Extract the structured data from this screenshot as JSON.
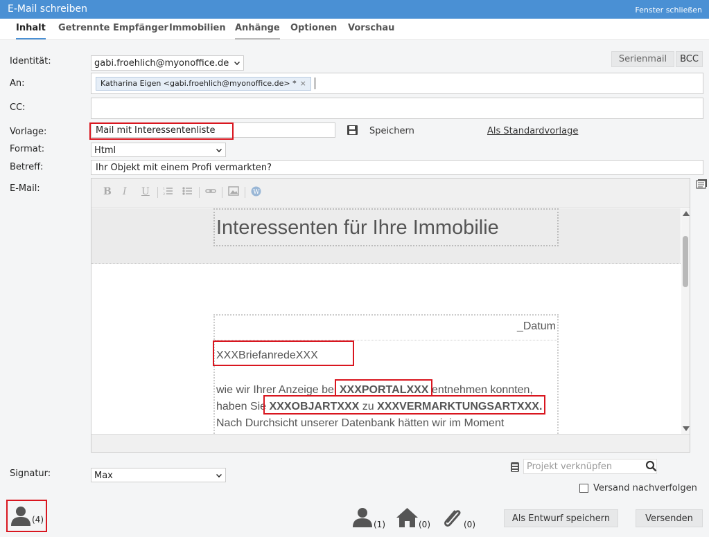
{
  "window": {
    "title": "E-Mail schreiben",
    "close_label": "Fenster schließen"
  },
  "tabs": [
    {
      "label": "Inhalt"
    },
    {
      "label": "Getrennte Empfänger"
    },
    {
      "label": "Immobilien"
    },
    {
      "label": "Anhänge"
    },
    {
      "label": "Optionen"
    },
    {
      "label": "Vorschau"
    }
  ],
  "form": {
    "identity_label": "Identität:",
    "identity_value": "gabi.froehlich@myonoffice.de",
    "serienmail_label": "Serienmail",
    "bcc_label": "BCC",
    "to_label": "An:",
    "to_chip": "Katharina Eigen <gabi.froehlich@myonoffice.de> *",
    "cc_label": "CC:",
    "template_label": "Vorlage:",
    "template_value": "Mail mit Interessentenliste",
    "save_label": "Speichern",
    "default_template_label": "Als Standardvorlage",
    "format_label": "Format:",
    "format_value": "Html",
    "subject_label": "Betreff:",
    "subject_value": "Ihr Objekt mit einem Profi vermarkten?",
    "email_label": "E-Mail:"
  },
  "editor": {
    "toolbar": {
      "bold": "B",
      "italic": "I",
      "underline": "U"
    },
    "header_text": "Interessenten für Ihre Immobilie",
    "date_text": "_Datum",
    "salutation": "XXXBriefanredeXXX",
    "para_1": "wie wir Ihrer Anzeige bei ",
    "portal": "XXXPORTALXXX",
    "para_2": " entnehmen konnten,",
    "para_3": "haben Sie ",
    "objart": "XXXOBJARTXXX",
    "para_4": " zu ",
    "vermarktungsart": "XXXVERMARKTUNGSARTXXX",
    "para_5": ".",
    "para_6": "Nach Durchsicht unserer Datenbank hätten wir im Moment"
  },
  "bottom": {
    "signature_label": "Signatur:",
    "signature_value": "Max",
    "project_placeholder": "Projekt verknüpfen",
    "track_label": "Versand nachverfolgen",
    "recipients_count": "(4)",
    "contacts_count": "(1)",
    "properties_count": "(0)",
    "attachments_count": "(0)",
    "draft_button": "Als Entwurf speichern",
    "send_button": "Versenden"
  },
  "colors": {
    "titlebar": "#4a90d4",
    "highlight": "#d9161f"
  }
}
